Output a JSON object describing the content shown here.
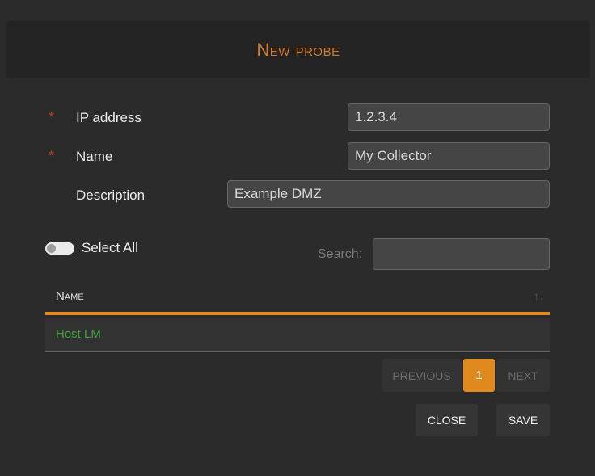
{
  "dialog": {
    "title": "New probe"
  },
  "form": {
    "ip": {
      "label": "IP address",
      "value": "1.2.3.4",
      "required": "*"
    },
    "name": {
      "label": "Name",
      "value": "My Collector",
      "required": "*"
    },
    "description": {
      "label": "Description",
      "value": "Example DMZ"
    }
  },
  "list": {
    "select_all_label": "Select All",
    "search_label": "Search:",
    "search_value": "",
    "column_name": "Name",
    "rows": [
      {
        "name": "Host LM"
      }
    ]
  },
  "pagination": {
    "previous": "PREVIOUS",
    "current": "1",
    "next": "NEXT"
  },
  "actions": {
    "close": "CLOSE",
    "save": "SAVE"
  },
  "colors": {
    "accent": "#e08a1e",
    "required": "#c0392b",
    "row_text": "#3aa43a"
  }
}
